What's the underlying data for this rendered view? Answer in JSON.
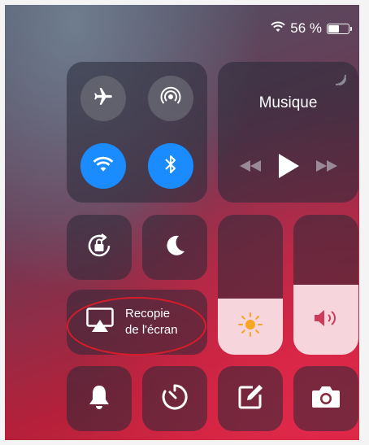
{
  "status_bar": {
    "wifi_icon": "wifi-icon",
    "battery_text": "56 %",
    "battery_level": 0.56
  },
  "connectivity": {
    "airplane": {
      "icon": "airplane-icon",
      "active": false
    },
    "airdrop": {
      "icon": "airdrop-icon",
      "active": false
    },
    "wifi": {
      "icon": "wifi-icon",
      "active": true
    },
    "bluetooth": {
      "icon": "bluetooth-icon",
      "active": true
    }
  },
  "music": {
    "title": "Musique",
    "controls": [
      "rewind-icon",
      "play-icon",
      "fast-forward-icon"
    ]
  },
  "orientation_lock": {
    "icon": "orientation-lock-icon"
  },
  "do_not_disturb": {
    "icon": "moon-icon"
  },
  "screen_mirroring": {
    "line1": "Recopie",
    "line2": "de l'écran",
    "icon": "airplay-icon"
  },
  "brightness": {
    "icon": "sun-icon",
    "level": 0.4
  },
  "volume": {
    "icon": "speaker-icon",
    "level": 0.5
  },
  "bottom_row": [
    "bell-icon",
    "timer-icon",
    "notes-icon",
    "camera-icon"
  ],
  "colors": {
    "accent_blue": "#1a8cff",
    "annotation_red": "#d91c2a"
  }
}
